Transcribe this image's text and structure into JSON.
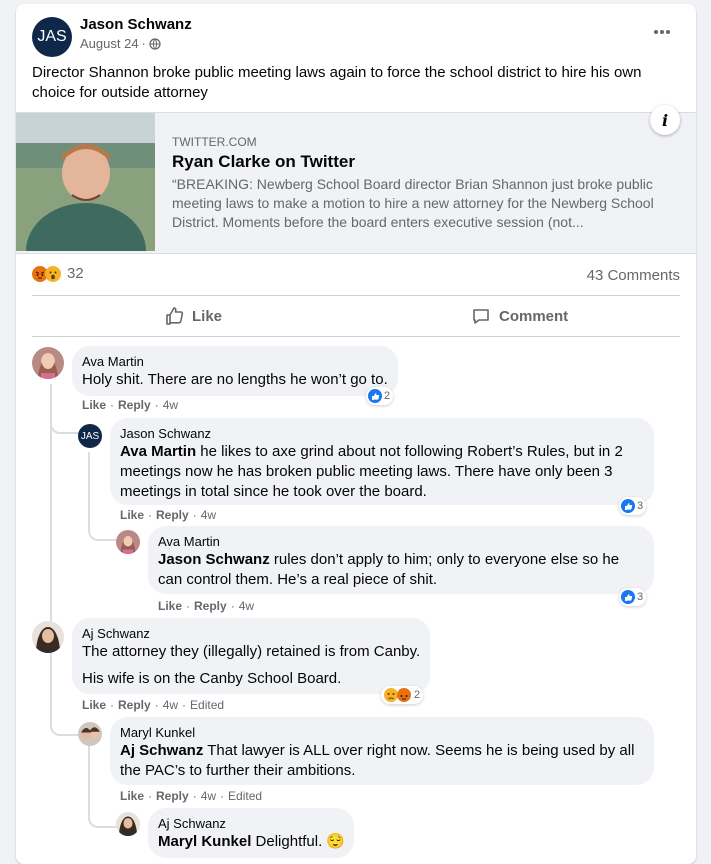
{
  "post": {
    "author": "Jason Schwanz",
    "avatar_initials": "JAS",
    "date": "August 24",
    "audience_icon": "globe-icon",
    "text": "Director Shannon broke public meeting laws again to force the school district to hire his own choice for outside attorney"
  },
  "link": {
    "domain": "TWITTER.COM",
    "title": "Ryan Clarke on Twitter",
    "description": "“BREAKING: Newberg School Board director Brian Shannon just broke public meeting laws to make a motion to hire a new attorney for the Newberg School District. Moments before the board enters executive session (not...",
    "info_icon": "i"
  },
  "stats": {
    "reaction_count": "32",
    "comments": "43 Comments"
  },
  "actions": {
    "like": "Like",
    "comment": "Comment"
  },
  "comments": [
    {
      "name": "Ava Martin",
      "text": "Holy shit. There are no lengths he won’t go to.",
      "like": "Like",
      "reply": "Reply",
      "time": "4w",
      "reactions": "2"
    },
    {
      "name": "Jason Schwanz",
      "avatar": "JAS",
      "mention": "Ava Martin",
      "text": " he likes to axe grind about not following Robert’s Rules, but in 2 meetings now he has broken public meeting laws. There have only been 3 meetings in total since he took over the board.",
      "like": "Like",
      "reply": "Reply",
      "time": "4w",
      "reactions": "3"
    },
    {
      "name": "Ava Martin",
      "mention": "Jason Schwanz",
      "text": " rules don’t apply to him; only to everyone else so he can control them. He’s a real piece of shit.",
      "like": "Like",
      "reply": "Reply",
      "time": "4w",
      "reactions": "3"
    },
    {
      "name": "Aj Schwanz",
      "text": "The attorney they (illegally) retained is from Canby.",
      "text2": "His wife is on the Canby School Board.",
      "like": "Like",
      "reply": "Reply",
      "time": "4w",
      "edited": "Edited",
      "reactions": "2"
    },
    {
      "name": "Maryl Kunkel",
      "mention": "Aj Schwanz",
      "text": " That lawyer is ALL over right now. Seems he is being used by all the PAC’s to further their ambitions.",
      "like": "Like",
      "reply": "Reply",
      "time": "4w",
      "edited": "Edited"
    },
    {
      "name": "Aj Schwanz",
      "mention": "Maryl Kunkel",
      "text": " Delightful. 😌"
    }
  ],
  "colors": {
    "accent": "#1877f2",
    "secondary_text": "#65676b",
    "bubble": "#f0f2f5"
  }
}
